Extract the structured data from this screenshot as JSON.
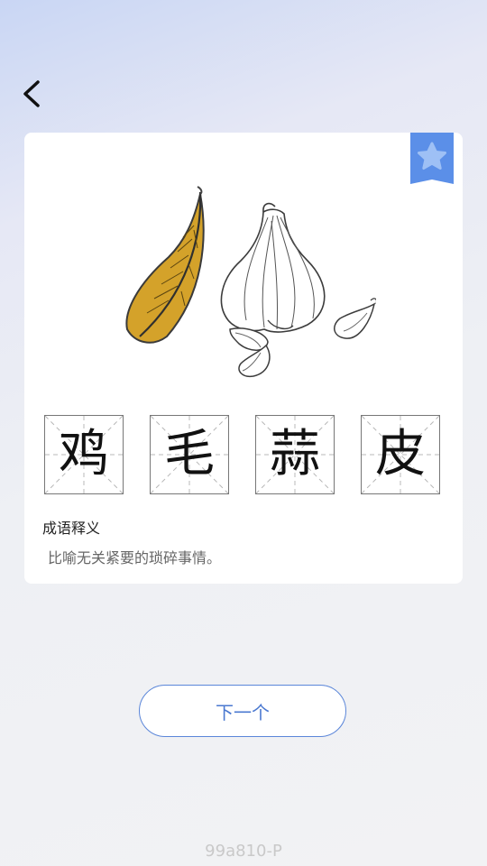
{
  "nav": {
    "back_icon": "chevron-left-icon"
  },
  "card": {
    "favorite_icon": "star-bookmark-icon",
    "illustration": "feather-and-garlic-illustration",
    "idiom_chars": [
      "鸡",
      "毛",
      "蒜",
      "皮"
    ],
    "meaning_title": "成语释义",
    "meaning_text": "比喻无关紧要的琐碎事情。"
  },
  "actions": {
    "next_label": "下一个"
  },
  "footer": {
    "id_text": "99a810-P"
  },
  "colors": {
    "accent": "#4a78d0",
    "badge": "#5b8fe8",
    "feather": "#d4a22a"
  }
}
